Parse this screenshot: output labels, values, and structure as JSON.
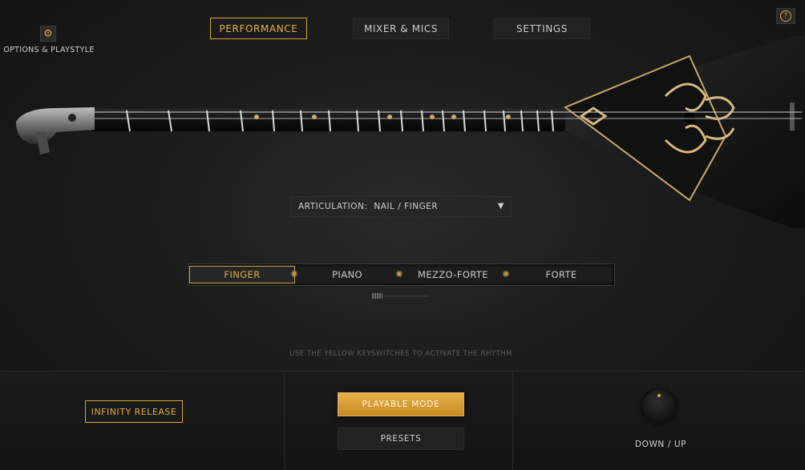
{
  "tabs": [
    {
      "label": "PERFORMANCE",
      "active": true
    },
    {
      "label": "MIXER & MICS",
      "active": false
    },
    {
      "label": "SETTINGS",
      "active": false
    }
  ],
  "options": {
    "label": "OPTIONS & PLAYSTYLE",
    "icon": "gear-icon"
  },
  "help": {
    "icon": "help-icon",
    "glyph": "?"
  },
  "articulation": {
    "label": "ARTICULATION:",
    "value": "NAIL / FINGER",
    "icon": "dropdown-arrow-icon"
  },
  "dynamics": {
    "segments": [
      {
        "label": "FINGER",
        "active": true
      },
      {
        "label": "PIANO",
        "active": false
      },
      {
        "label": "MEZZO-FORTE",
        "active": false
      },
      {
        "label": "FORTE",
        "active": false
      }
    ]
  },
  "hint": "USE THE YELLOW KEYSWITCHES TO ACTIVATE THE RHYTHM",
  "buttons": {
    "infinity_release": "INFINITY RELEASE",
    "playable_mode": "PLAYABLE MODE",
    "presets": "PRESETS"
  },
  "knob": {
    "label": "DOWN / UP"
  },
  "colors": {
    "accent": "#d9a43a",
    "background": "#1c1c1c",
    "text": "#c9c9c9"
  }
}
